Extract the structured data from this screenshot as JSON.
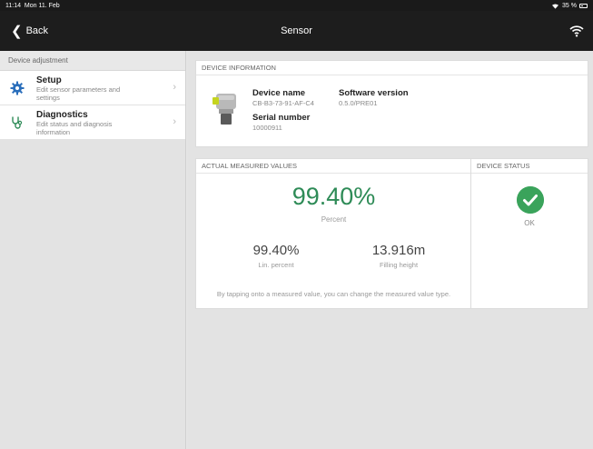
{
  "statusbar": {
    "time": "11:14",
    "date": "Mon 11. Feb",
    "battery": "35 %"
  },
  "navbar": {
    "back_label": "Back",
    "title": "Sensor"
  },
  "sidebar": {
    "header": "Device adjustment",
    "items": [
      {
        "title": "Setup",
        "subtitle": "Edit sensor parameters and settings",
        "icon": "gear-icon"
      },
      {
        "title": "Diagnostics",
        "subtitle": "Edit status and diagnosis information",
        "icon": "stethoscope-icon"
      }
    ]
  },
  "device_info": {
    "header": "DEVICE INFORMATION",
    "device_name_label": "Device name",
    "device_name": "CB-B3-73-91-AF-C4",
    "software_version_label": "Software version",
    "software_version": "0.5.0/PRE01",
    "serial_number_label": "Serial number",
    "serial_number": "10000911"
  },
  "measured": {
    "header": "ACTUAL MEASURED VALUES",
    "primary_value": "99.40%",
    "primary_label": "Percent",
    "lin_value": "99.40%",
    "lin_label": "Lin. percent",
    "height_value": "13.916m",
    "height_label": "Filling height",
    "hint": "By tapping onto a measured value, you can change the measured value type."
  },
  "device_status": {
    "header": "DEVICE STATUS",
    "status": "OK",
    "icon": "check-circle-icon",
    "color": "#3aa35b"
  },
  "colors": {
    "accent_green": "#2e8b57",
    "nav_bg": "#1d1d1d",
    "icon_blue": "#2a6ebb"
  }
}
